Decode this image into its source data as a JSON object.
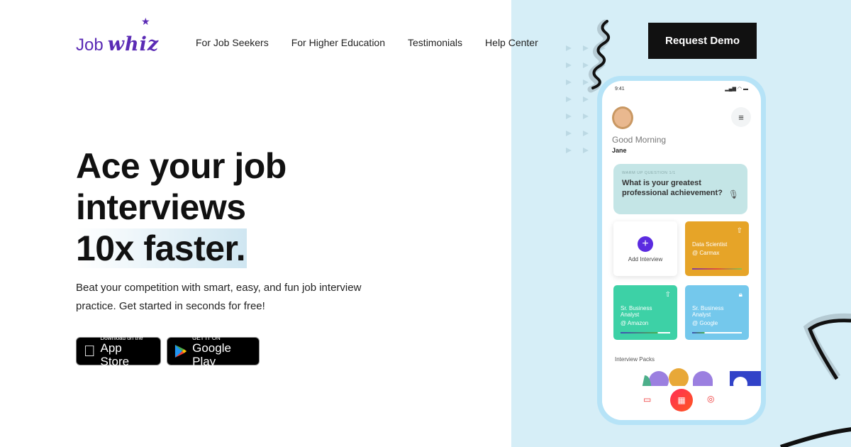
{
  "brand": {
    "part1": "Job",
    "part2": "whiz",
    "color": "#5b2bb5"
  },
  "nav": {
    "items": [
      "For Job Seekers",
      "For Higher Education",
      "Testimonials",
      "Help Center"
    ],
    "cta": "Request Demo"
  },
  "hero": {
    "line1": "Ace your job",
    "line2": "interviews",
    "line3": "10x faster.",
    "subtitle": "Beat your competition with smart, easy, and fun job interview practice. Get started in seconds for free!"
  },
  "stores": {
    "apple": {
      "small": "Download on the",
      "big": "App Store"
    },
    "google": {
      "small": "GET IT ON",
      "big": "Google Play"
    }
  },
  "phone": {
    "time": "9:41",
    "status_icons": "signal wifi battery",
    "greeting": "Good Morning",
    "user": "Jane",
    "question_label": "WARM UP QUESTION 1/1",
    "question": "What is your greatest professional achievement?",
    "add_interview": "Add Interview",
    "cards": [
      {
        "title": "Data Scientist",
        "company": "@ Carmax",
        "color": "#e6a428",
        "icon": "rocket-icon",
        "progress": 1.0
      },
      {
        "title": "Sr. Business Analyst",
        "company": "@ Amazon",
        "color": "#3dd1a6",
        "icon": "rocket-icon",
        "progress": 0.75
      },
      {
        "title": "Sr. Business Analyst",
        "company": "@ Google",
        "color": "#74c8ec",
        "icon": "lock-icon",
        "progress": 0.25
      }
    ],
    "packs_label": "Interview Packs"
  }
}
